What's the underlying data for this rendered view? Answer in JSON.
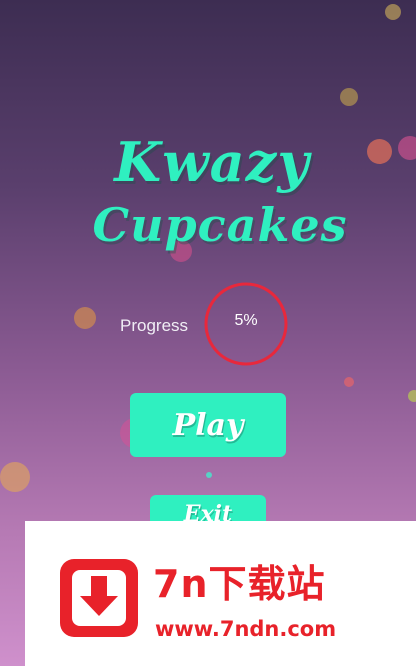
{
  "game": {
    "title_line1": "Kwazy",
    "title_line2": "Cupcakes",
    "progress_label": "Progress",
    "progress_value": "5%",
    "progress_fraction": 0.05,
    "play_label": "Play",
    "exit_label": "Exit"
  },
  "ad_banner": {
    "title": "7n下载站",
    "url": "www.7ndn.com"
  },
  "colors": {
    "accent": "#2ff0c0",
    "progress_ring": "#e8283c",
    "ad_red": "#e8222a"
  },
  "icons": {
    "ad_logo": "download-arrow-icon"
  }
}
